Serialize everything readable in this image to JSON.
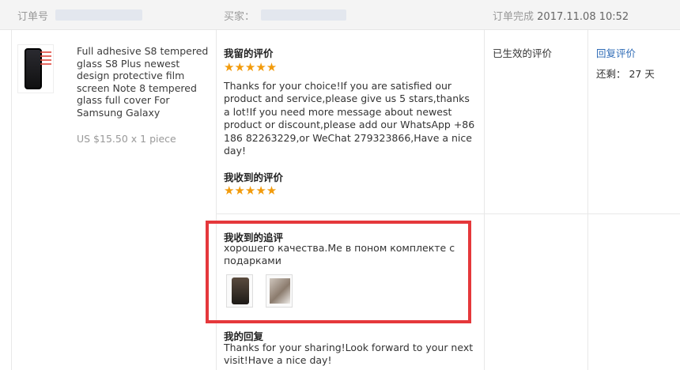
{
  "header": {
    "order_no_label": "订单号",
    "buyer_label": "买家：",
    "completed_label": "订单完成",
    "completed_time": "2017.11.08 10:52"
  },
  "product": {
    "title": "Full adhesive S8 tempered glass S8 Plus newest design protective film screen Note 8 tempered glass full cover For Samsung Galaxy",
    "price": "US $15.50 x 1 piece"
  },
  "my_review": {
    "title": "我留的评价",
    "stars": "★★★★★",
    "text": "Thanks for your choice!If you are satisfied our product and service,please give us 5 stars,thanks a lot!If you need more message about newest product or discount,please add our WhatsApp +86 186 82263229,or WeChat 279323866,Have a nice day!"
  },
  "received_review": {
    "title": "我收到的评价",
    "stars": "★★★★★"
  },
  "followup": {
    "title": "我收到的追评",
    "text": "хорошего качества.Ме в поном комплекте с подарками"
  },
  "my_reply": {
    "title": "我的回复",
    "text": "Thanks for your sharing!Look forward to your next visit!Have a nice day!"
  },
  "status": {
    "text": "已生效的评价"
  },
  "actions": {
    "reply_label": "回复评价",
    "remaining": "还剩： 27 天"
  },
  "colors": {
    "star": "#f29b0c",
    "link": "#2e6bb6",
    "highlight": "#e5383b"
  }
}
